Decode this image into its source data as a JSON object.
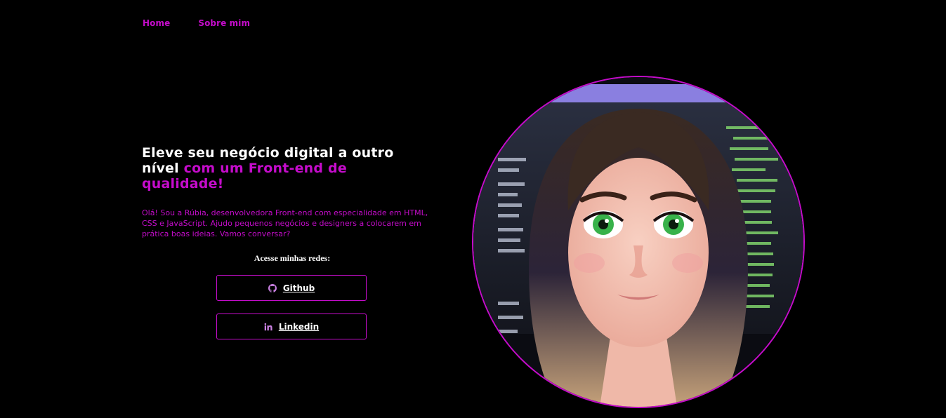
{
  "nav": {
    "items": [
      {
        "label": "Home"
      },
      {
        "label": "Sobre mim"
      }
    ]
  },
  "hero": {
    "headline_white": "Eleve seu negócio digital a outro nível ",
    "headline_accent": "com um Front-end de qualidade!",
    "intro": "Olá! Sou a Rúbia, desenvolvedora Front-end com especialidade em HTML, CSS e JavaScript. Ajudo pequenos negócios e designers a colocarem em prática boas ideias. Vamos conversar?",
    "social_title": "Acesse minhas redes:",
    "buttons": [
      {
        "label": "Github",
        "icon": "github-icon"
      },
      {
        "label": "Linkedin",
        "icon": "linkedin-icon"
      }
    ]
  },
  "colors": {
    "background": "#000000",
    "accent": "#C50CCB",
    "text": "#FFFFFF"
  },
  "image": {
    "subject": "cartoon-portrait-avatar"
  }
}
